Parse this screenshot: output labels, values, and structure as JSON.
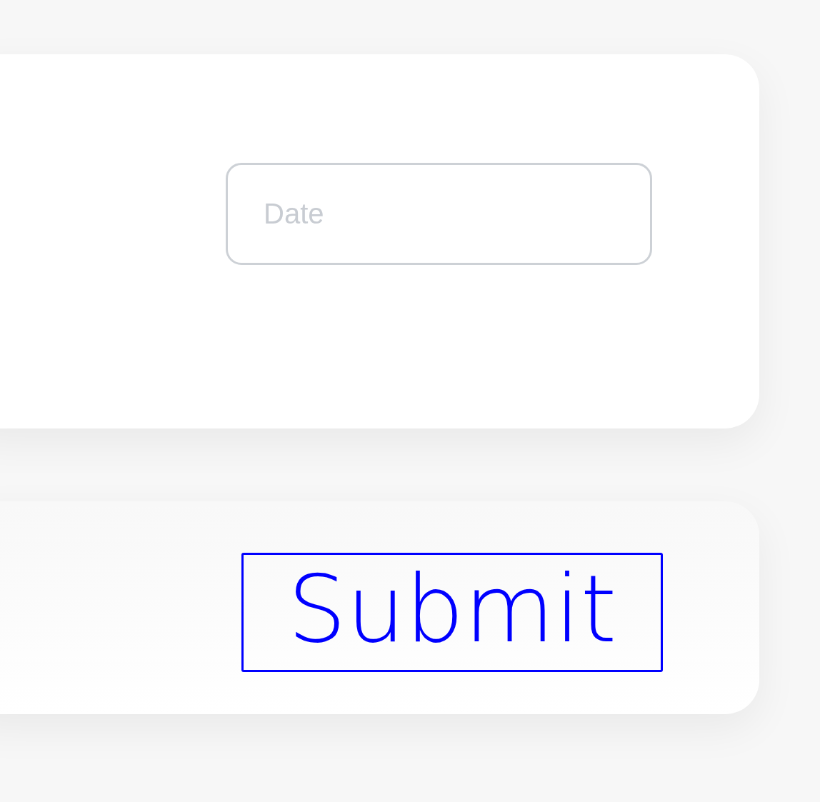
{
  "date_field": {
    "placeholder": "Date"
  },
  "submit_button": {
    "label": "Submit"
  }
}
